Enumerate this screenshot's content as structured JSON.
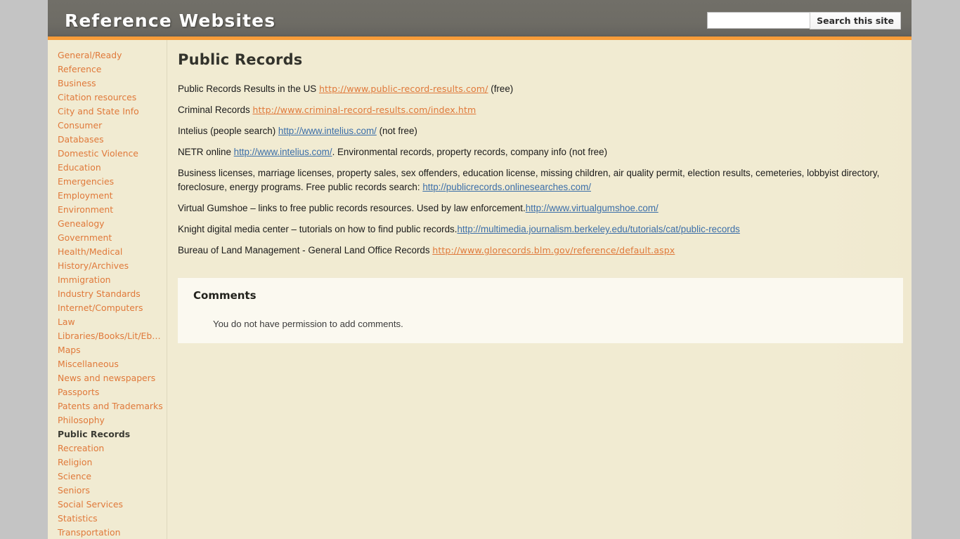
{
  "header": {
    "site_title": "Reference Websites",
    "search_value": "",
    "search_placeholder": "",
    "search_button_label": "Search this site"
  },
  "sidebar": {
    "items": [
      {
        "label": "General/Ready Reference",
        "active": false,
        "wrap": true
      },
      {
        "label": "Business",
        "active": false
      },
      {
        "label": "Citation resources",
        "active": false
      },
      {
        "label": "City and State Info",
        "active": false
      },
      {
        "label": "Consumer",
        "active": false
      },
      {
        "label": "Databases",
        "active": false
      },
      {
        "label": "Domestic Violence",
        "active": false
      },
      {
        "label": "Education",
        "active": false
      },
      {
        "label": "Emergencies",
        "active": false
      },
      {
        "label": "Employment",
        "active": false
      },
      {
        "label": "Environment",
        "active": false
      },
      {
        "label": "Genealogy",
        "active": false
      },
      {
        "label": "Government",
        "active": false
      },
      {
        "label": "Health/Medical",
        "active": false
      },
      {
        "label": "History/Archives",
        "active": false
      },
      {
        "label": "Immigration",
        "active": false
      },
      {
        "label": "Industry Standards",
        "active": false
      },
      {
        "label": "Internet/Computers",
        "active": false
      },
      {
        "label": "Law",
        "active": false
      },
      {
        "label": "Libraries/Books/Lit/Eb…",
        "active": false
      },
      {
        "label": "Maps",
        "active": false
      },
      {
        "label": "Miscellaneous",
        "active": false
      },
      {
        "label": "News and newspapers",
        "active": false
      },
      {
        "label": "Passports",
        "active": false
      },
      {
        "label": "Patents and Trademarks",
        "active": false
      },
      {
        "label": "Philosophy",
        "active": false
      },
      {
        "label": "Public Records",
        "active": true
      },
      {
        "label": "Recreation",
        "active": false
      },
      {
        "label": "Religion",
        "active": false
      },
      {
        "label": "Science",
        "active": false
      },
      {
        "label": "Seniors",
        "active": false
      },
      {
        "label": "Social Services",
        "active": false
      },
      {
        "label": "Statistics",
        "active": false
      },
      {
        "label": "Transportation",
        "active": false
      }
    ]
  },
  "main": {
    "page_title": "Public Records",
    "paragraphs": [
      {
        "id": "p-public-record-results",
        "parts": [
          {
            "type": "text",
            "value": "Public Records Results in the US "
          },
          {
            "type": "link",
            "style": "orange",
            "value": "http://www.public-record-results.com/"
          },
          {
            "type": "text",
            "value": " (free)"
          }
        ]
      },
      {
        "id": "p-criminal-records",
        "parts": [
          {
            "type": "text",
            "value": "Criminal Records "
          },
          {
            "type": "link",
            "style": "orange",
            "value": "http://www.criminal-record-results.com/index.htm"
          }
        ]
      },
      {
        "id": "p-intelius",
        "parts": [
          {
            "type": "text",
            "value": "Intelius (people search) "
          },
          {
            "type": "link",
            "style": "blue",
            "value": "http://www.intelius.com/"
          },
          {
            "type": "text",
            "value": " (not free)"
          }
        ]
      },
      {
        "id": "p-netr-online",
        "parts": [
          {
            "type": "text",
            "value": "NETR online "
          },
          {
            "type": "link",
            "style": "blue",
            "value": "http://www.intelius.com/"
          },
          {
            "type": "text",
            "value": ". Environmental records, property records, company info (not free)"
          }
        ]
      },
      {
        "id": "p-business-licenses",
        "parts": [
          {
            "type": "text",
            "value": "Business licenses, marriage licenses, property sales, sex offenders, education license, missing children, air quality permit, election results, cemeteries, lobbyist directory, foreclosure, energy programs. Free public records search: "
          },
          {
            "type": "link",
            "style": "blue",
            "value": "http://publicrecords.onlinesearches.com/"
          }
        ]
      },
      {
        "id": "p-virtual-gumshoe",
        "parts": [
          {
            "type": "text",
            "value": "Virtual Gumshoe – links to free public records resources. Used by law enforcement."
          },
          {
            "type": "link",
            "style": "blue",
            "value": "http://www.virtualgumshoe.com/"
          }
        ]
      },
      {
        "id": "p-knight-digital",
        "parts": [
          {
            "type": "text",
            "value": "Knight digital media center – tutorials on how to find public records."
          },
          {
            "type": "link",
            "style": "blue",
            "value": "http://multimedia.journalism.berkeley.edu/tutorials/cat/public-records"
          }
        ]
      },
      {
        "id": "p-blm-glo",
        "parts": [
          {
            "type": "text",
            "value": "Bureau of Land Management - General Land Office Records  "
          },
          {
            "type": "link",
            "style": "orange",
            "value": "http://www.glorecords.blm.gov/reference/default.aspx"
          }
        ]
      }
    ]
  },
  "comments": {
    "heading": "Comments",
    "message": "You do not have permission to add comments."
  },
  "colors": {
    "page_background": "#c4c4c4",
    "content_background": "#f1ebd2",
    "header_gray": "#6e6c65",
    "accent_orange": "#f89c39",
    "link_orange": "#e0793a",
    "link_blue": "#3b6ea8",
    "comments_background": "#fbf9f0"
  }
}
